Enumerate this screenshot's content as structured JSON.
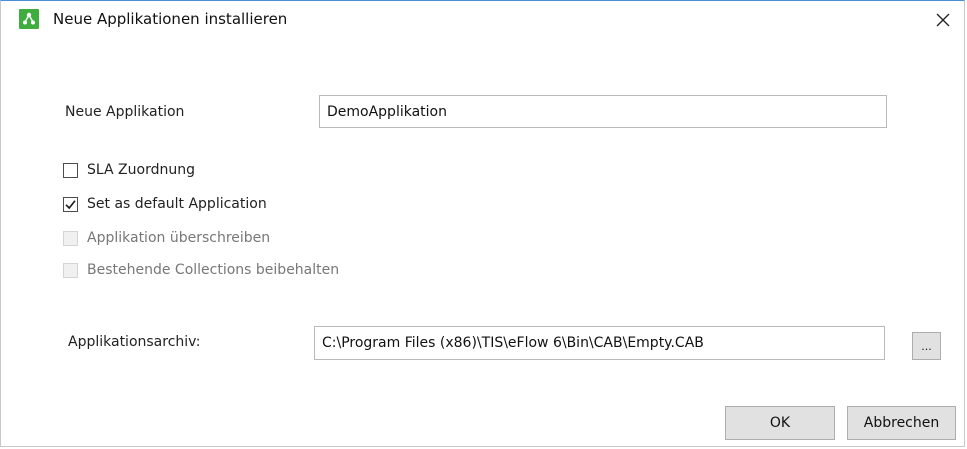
{
  "window": {
    "title": "Neue Applikationen installieren",
    "close_glyph": "✕",
    "icon": "app-network-icon",
    "icon_color": "#3fae3f"
  },
  "form": {
    "app_name_label": "Neue Applikation",
    "app_name_value": "DemoApplikation",
    "options": [
      {
        "label": "SLA Zuordnung",
        "checked": false,
        "enabled": true
      },
      {
        "label": "Set as default Application",
        "checked": true,
        "enabled": true
      },
      {
        "label": "Applikation überschreiben",
        "checked": false,
        "enabled": false
      },
      {
        "label": "Bestehende Collections beibehalten",
        "checked": false,
        "enabled": false
      }
    ],
    "archive_label": "Applikationsarchiv:",
    "archive_value": "C:\\Program Files (x86)\\TIS\\eFlow 6\\Bin\\CAB\\Empty.CAB",
    "browse_label": "..."
  },
  "buttons": {
    "ok_label": "OK",
    "cancel_label": "Abbrechen"
  }
}
